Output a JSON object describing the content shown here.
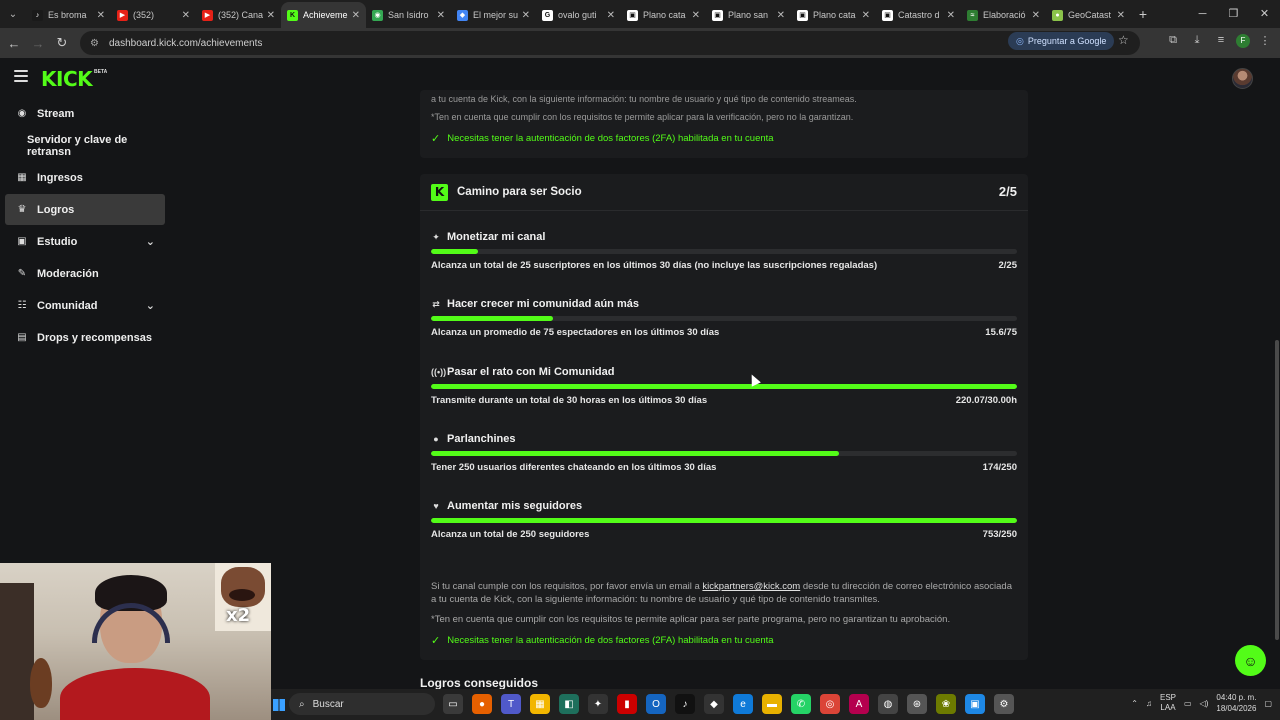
{
  "browser": {
    "tabs": [
      {
        "label": "Es broma",
        "color": "#1a1a1a",
        "glyph": "♪"
      },
      {
        "label": "(352)",
        "color": "#e62117",
        "glyph": "▶"
      },
      {
        "label": "(352) Cana",
        "color": "#e62117",
        "glyph": "▶"
      },
      {
        "label": "Achievements",
        "color": "#53fc18",
        "glyph": "K"
      },
      {
        "label": "San Isidro",
        "color": "#34a853",
        "glyph": "◉"
      },
      {
        "label": "El mejor su",
        "color": "#4285f4",
        "glyph": "◆"
      },
      {
        "label": "ovalo guti",
        "color": "#ffffff",
        "glyph": "G"
      },
      {
        "label": "Plano cata",
        "color": "#ffffff",
        "glyph": "▣"
      },
      {
        "label": "Plano san",
        "color": "#ffffff",
        "glyph": "▣"
      },
      {
        "label": "Plano cata",
        "color": "#ffffff",
        "glyph": "▣"
      },
      {
        "label": "Catastro d",
        "color": "#ffffff",
        "glyph": "▣"
      },
      {
        "label": "Elaboració",
        "color": "#2e7d32",
        "glyph": "≈"
      },
      {
        "label": "GeoCatast",
        "color": "#8bc34a",
        "glyph": "●"
      }
    ],
    "url": "dashboard.kick.com/achievements",
    "ask_google": "Preguntar a Google",
    "profile_initial": "F"
  },
  "header": {
    "logo": "KICK",
    "beta": "BETA"
  },
  "sidebar": {
    "items": [
      {
        "label": "Stream",
        "icon": "((•))"
      },
      {
        "label": "Servidor y clave de retransn",
        "icon": ""
      },
      {
        "label": "Ingresos",
        "icon": "▦"
      },
      {
        "label": "Logros",
        "icon": "🏆"
      },
      {
        "label": "Estudio",
        "icon": "▣"
      },
      {
        "label": "Moderación",
        "icon": "🔧"
      },
      {
        "label": "Comunidad",
        "icon": "👥"
      },
      {
        "label": "Drops y recompensas",
        "icon": "▤"
      }
    ]
  },
  "top_card": {
    "text_partial": "a tu cuenta de Kick, con la siguiente información: tu nombre de usuario y qué tipo de contenido streameas.",
    "disclaimer": "*Ten en cuenta que cumplir con los requisitos te permite aplicar para la verificación, pero no la garantizan.",
    "twofa": "Necesitas tener la autenticación de dos factores (2FA) habilitada en tu cuenta"
  },
  "partner": {
    "title": "Camino para ser Socio",
    "count": "2/5",
    "achievements": [
      {
        "title": "Monetizar mi canal",
        "icon": "✦",
        "desc": "Alcanza un total de 25 suscriptores en los últimos 30 días (no incluye las suscripciones regaladas)",
        "value": "2/25",
        "progress": 0.08
      },
      {
        "title": "Hacer crecer mi comunidad aún más",
        "icon": "⇄",
        "desc": "Alcanza un promedio de 75 espectadores en los últimos 30 días",
        "value": "15.6/75",
        "progress": 0.208
      },
      {
        "title": "Pasar el rato con Mi Comunidad",
        "icon": "((•))",
        "desc": "Transmite durante un total de 30 horas en los últimos 30 días",
        "value": "220.07/30.00h",
        "progress": 1.0
      },
      {
        "title": "Parlanchines",
        "icon": "●",
        "desc": "Tener 250 usuarios diferentes chateando en los últimos 30 días",
        "value": "174/250",
        "progress": 0.696
      },
      {
        "title": "Aumentar mis seguidores",
        "icon": "♥",
        "desc": "Alcanza un total de 250 seguidores",
        "value": "753/250",
        "progress": 1.0
      }
    ],
    "footer_text_1": "Si tu canal cumple con los requisitos, por favor envía un email a ",
    "footer_email": "kickpartners@kick.com",
    "footer_text_2": " desde tu dirección de correo electrónico asociada a tu cuenta de Kick, con la siguiente información: tu nombre de usuario y qué tipo de contenido transmites.",
    "footer_disclaimer": "*Ten en cuenta que cumplir con los requisitos te permite aplicar para ser parte programa, pero no garantizan tu aprobación.",
    "footer_twofa": "Necesitas tener la autenticación de dos factores (2FA) habilitada en tu cuenta"
  },
  "section_title": "Logros conseguidos",
  "webcam": {
    "sticker_text": "x2"
  },
  "taskbar": {
    "search": "Buscar",
    "lang": "ESP",
    "lang2": "LAA",
    "time": "04:40 p. m.",
    "date": "18/04/2026"
  },
  "colors": {
    "accent": "#53fc18",
    "card_bg": "#1b1c1e",
    "page_bg": "#141517"
  }
}
